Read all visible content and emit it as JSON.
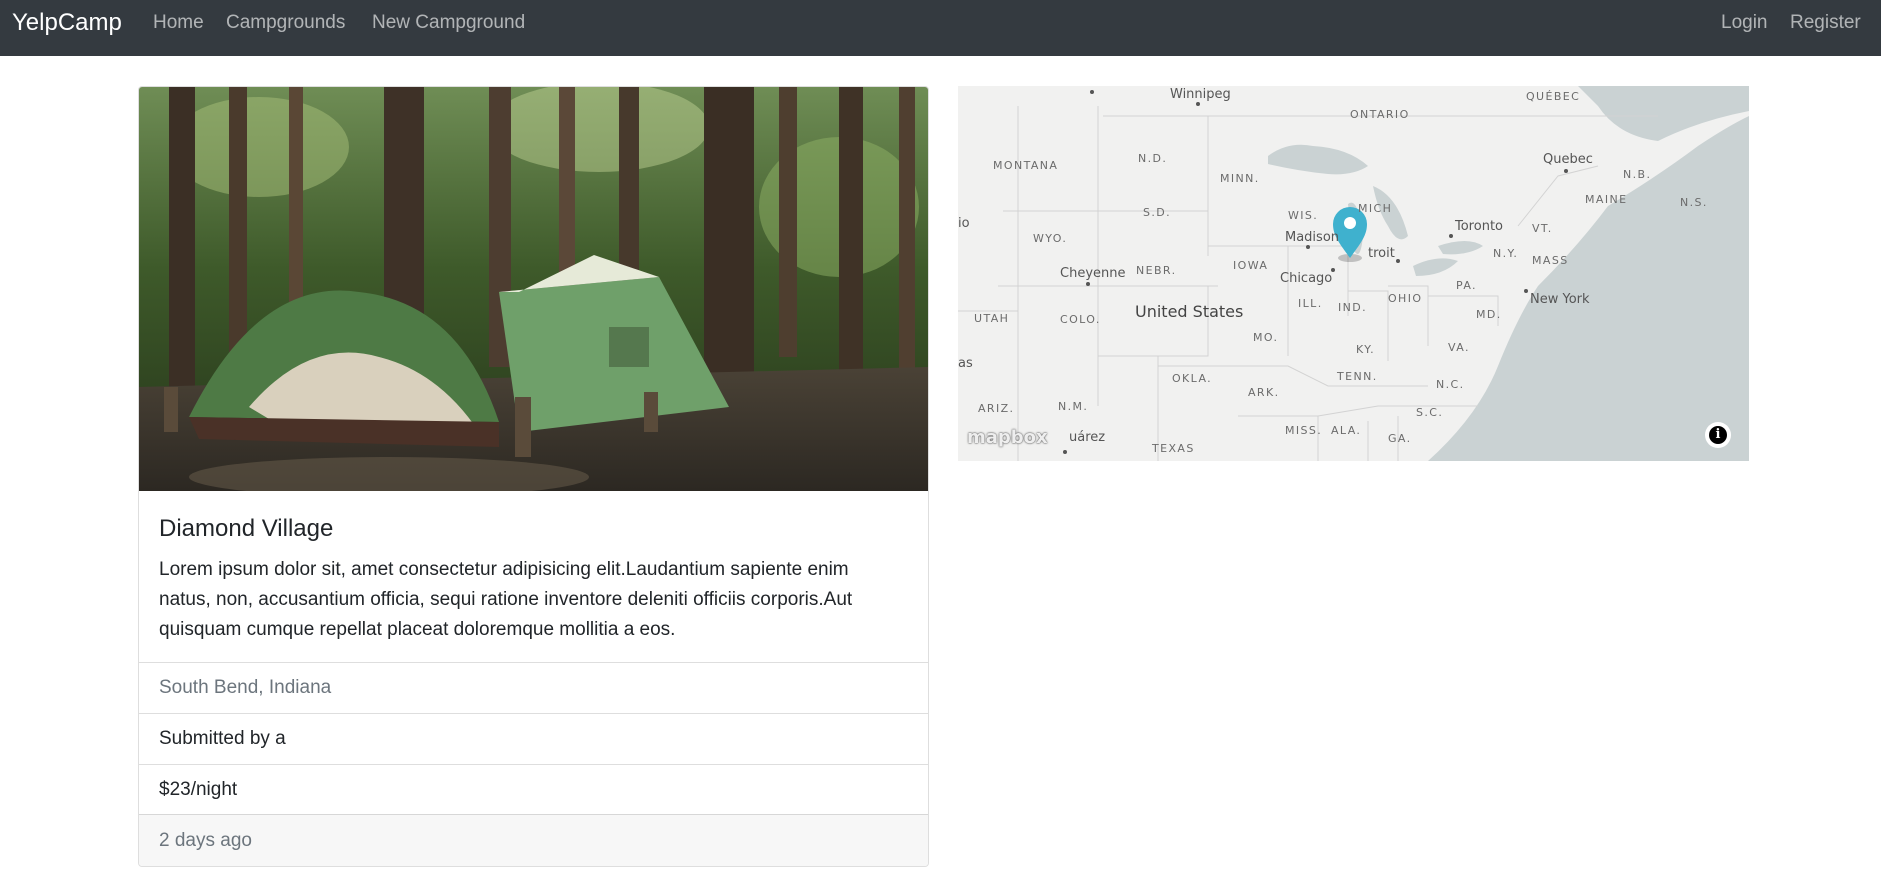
{
  "navbar": {
    "brand": "YelpCamp",
    "links": [
      "Home",
      "Campgrounds",
      "New Campground"
    ],
    "login": "Login",
    "register": "Register"
  },
  "campground": {
    "title": "Diamond Village",
    "description": "Lorem ipsum dolor sit, amet consectetur adipisicing elit.Laudantium sapiente enim natus, non, accusantium officia, sequi ratione inventore deleniti officiis corporis.Aut quisquam cumque repellat placeat doloremque mollitia a eos.",
    "location": "South Bend, Indiana",
    "submitted_by": "Submitted by a",
    "price": "$23/night",
    "posted": "2 days ago"
  },
  "map": {
    "attribution_logo": "mapbox",
    "country_label": "United States",
    "state_labels": [
      "MONTANA",
      "N.D.",
      "MINN.",
      "S.D.",
      "WYO.",
      "NEBR.",
      "IOWA",
      "WIS.",
      "MICH",
      "UTAH",
      "COLO.",
      "ILL.",
      "IND.",
      "OHIO",
      "PA.",
      "N.Y.",
      "MASS",
      "VT.",
      "MAINE",
      "N.B.",
      "N.S.",
      "MD.",
      "VA.",
      "KY.",
      "MO.",
      "OKLA.",
      "ARK.",
      "TENN.",
      "N.C.",
      "S.C.",
      "MISS.",
      "ALA.",
      "GA.",
      "ARIZ.",
      "N.M.",
      "TEXAS",
      "ONTARIO",
      "QUÉBEC"
    ],
    "city_labels": [
      "Winnipeg",
      "Cheyenne",
      "Madison",
      "Chicago",
      "troit",
      "Toronto",
      "Quebec",
      "New York",
      "uárez",
      "as",
      "io"
    ],
    "marker_color": "#3fb1ce"
  }
}
